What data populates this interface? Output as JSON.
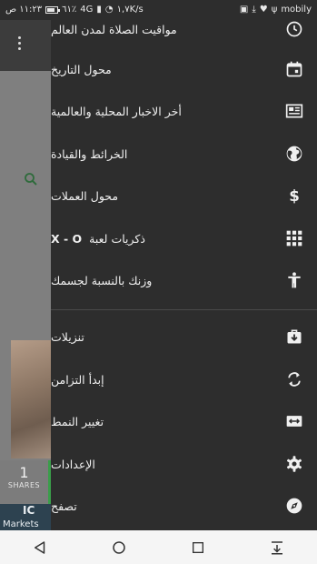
{
  "status_bar": {
    "time": "١١:٢٣ ص",
    "battery": "٦١٪",
    "signal_label": "4G",
    "speed": "١,٧K/s",
    "carrier": "mobily"
  },
  "background_app": {
    "shares_count": "1",
    "shares_label": "SHARES",
    "ad_logo": "IC",
    "ad_text": "Markets"
  },
  "drawer": {
    "items": [
      {
        "label": "مواقيت الصلاة لمدن العالم",
        "icon": "clock-icon"
      },
      {
        "label": "محول التاريخ",
        "icon": "calendar-icon"
      },
      {
        "label": "أخر الاخبار المحلية والعالمية",
        "icon": "newspaper-icon"
      },
      {
        "label": "الخرائط والقيادة",
        "icon": "globe-icon"
      },
      {
        "label": "محول العملات",
        "icon": "dollar-icon"
      },
      {
        "label": "ذكريات لعبة",
        "suffix": "X - O",
        "icon": "grid-icon"
      },
      {
        "label": "وزنك بالنسبة لجسمك",
        "icon": "person-icon"
      },
      {
        "label": "تنزيلات",
        "icon": "download-bag-icon"
      },
      {
        "label": "إبدأ التزامن",
        "icon": "sync-icon"
      },
      {
        "label": "تغيير النمط",
        "icon": "resize-icon"
      },
      {
        "label": "الإعدادات",
        "icon": "gear-icon"
      },
      {
        "label": "تصفح",
        "icon": "compass-icon"
      }
    ]
  },
  "colors": {
    "drawer_bg": "#2d2d2d",
    "text": "#f0f0f0",
    "accent_green": "#3a9e4a"
  }
}
